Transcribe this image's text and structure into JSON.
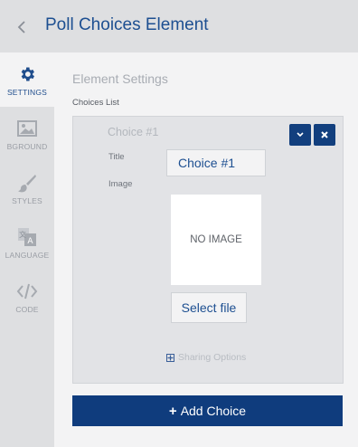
{
  "header": {
    "title": "Poll Choices Element"
  },
  "sidebar": {
    "items": [
      {
        "label": "SETTINGS",
        "icon": "gear-icon",
        "active": true
      },
      {
        "label": "BGROUND",
        "icon": "image-icon",
        "active": false
      },
      {
        "label": "STYLES",
        "icon": "brush-icon",
        "active": false
      },
      {
        "label": "LANGUAGE",
        "icon": "translate-icon",
        "active": false
      },
      {
        "label": "CODE",
        "icon": "code-icon",
        "active": false
      }
    ]
  },
  "main": {
    "section_title": "Element Settings",
    "choices_label": "Choices List",
    "choice": {
      "heading": "Choice #1",
      "title_label": "Title",
      "title_value": "Choice #1",
      "image_label": "Image",
      "image_placeholder": "NO IMAGE",
      "select_file_label": "Select file",
      "sharing_label": "Sharing Options"
    },
    "add_choice_label": "Add Choice"
  },
  "colors": {
    "accent": "#123f7e",
    "title": "#1d4f91",
    "active_label": "#1f4d8c"
  }
}
